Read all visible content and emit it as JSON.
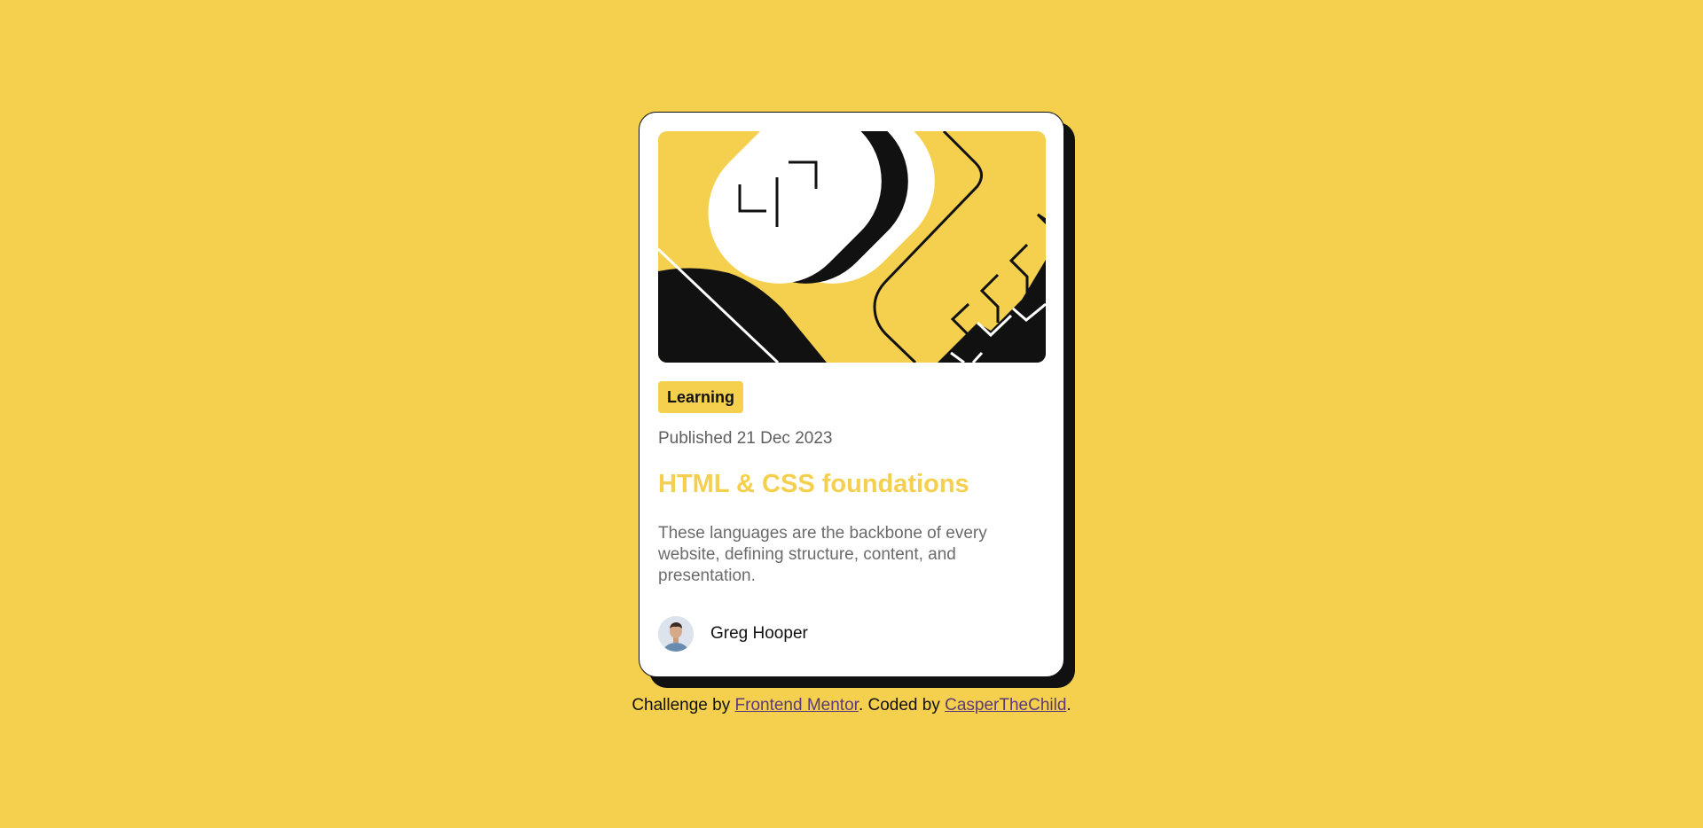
{
  "card": {
    "tag": "Learning",
    "published": "Published 21 Dec 2023",
    "title": "HTML & CSS foundations",
    "description": "These languages are the backbone of every website, defining structure, content, and presentation.",
    "author": "Greg Hooper"
  },
  "attribution": {
    "prefix": "Challenge by ",
    "link1": "Frontend Mentor",
    "middle": ". Coded by ",
    "link2": "CasperTheChild",
    "suffix": "."
  },
  "colors": {
    "background": "#F4D04E",
    "accent": "#F4D04E",
    "ink": "#111111",
    "card": "#FFFFFF"
  }
}
